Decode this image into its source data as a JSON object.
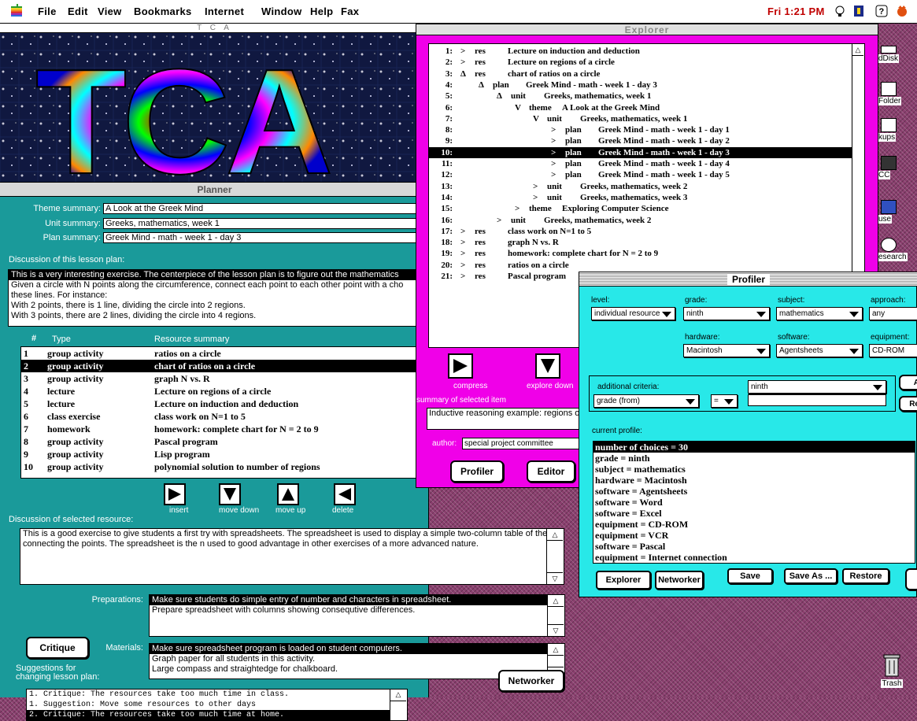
{
  "menubar": {
    "apple": "apple-icon",
    "items": [
      "File",
      "Edit",
      "View",
      "Bookmarks",
      "Internet",
      "Window",
      "Help",
      "Fax"
    ],
    "clock": "Fri 1:21 PM"
  },
  "desktop": {
    "icons": [
      {
        "label": "dDisk"
      },
      {
        "label": " Folder"
      },
      {
        "label": "kups"
      },
      {
        "label": "CC"
      },
      {
        "label": "use"
      },
      {
        "label": "esearch"
      },
      {
        "label": "Trash"
      }
    ]
  },
  "planner": {
    "tca_title": "T C A",
    "banner_text": "TCA",
    "title": "Planner",
    "theme_label": "Theme summary:",
    "theme_value": "A Look at the Greek Mind",
    "unit_label": "Unit summary:",
    "unit_value": "Greeks, mathematics, week 1",
    "plan_label": "Plan summary:",
    "plan_value": "Greek Mind - math - week 1 -  day  3",
    "discussion_label": "Discussion of this lesson plan:",
    "discussion_lines": [
      "This is a very interesting exercise. The centerpiece of the lesson plan is to figure out the mathematics",
      "Given a circle with N points along the circumference, connect each point to each other point with a cho",
      "these lines. For instance:",
      " With 2 points, there is 1 line, dividing the circle into 2 regions.",
      " With 3 points, there are 2 lines, dividing the circle into 4 regions."
    ],
    "col_num": "#",
    "col_type": "Type",
    "col_summary": "Resource summary",
    "resources": [
      {
        "n": "1",
        "type": "group activity",
        "summary": "ratios on a circle"
      },
      {
        "n": "2",
        "type": "group activity",
        "summary": "chart of ratios on  a circle"
      },
      {
        "n": "3",
        "type": "group activity",
        "summary": "graph N vs. R"
      },
      {
        "n": "4",
        "type": "lecture",
        "summary": "Lecture on regions of a circle"
      },
      {
        "n": "5",
        "type": "lecture",
        "summary": "Lecture on induction and deduction"
      },
      {
        "n": "6",
        "type": "class exercise",
        "summary": "class work on N=1 to 5"
      },
      {
        "n": "7",
        "type": "homework",
        "summary": "homework: complete chart for N = 2 to 9"
      },
      {
        "n": "8",
        "type": "group activity",
        "summary": "Pascal program"
      },
      {
        "n": "9",
        "type": "group activity",
        "summary": "Lisp program"
      },
      {
        "n": "10",
        "type": "group activity",
        "summary": "polynomial solution to number of regions"
      }
    ],
    "selected_resource": 2,
    "insert_label": "insert",
    "move_down_label": "move down",
    "move_up_label": "move up",
    "delete_label": "delete",
    "sel_resource_label": "Discussion of selected resource:",
    "sel_resource_lines": [
      "This is a good exercise to give students a first try with spreadsheets. The spreadsheet is used to display a simple two-column table of the",
      "connecting the points. The spreadsheet is the n used to good advantage in other exercises of a more advanced nature."
    ],
    "preparations_label": "Preparations:",
    "preparations_lines": [
      "Make sure students do simple entry of number and characters in spreadsheet.",
      "Prepare spreadsheet with columns showing consequtive differences."
    ],
    "critique_button": "Critique",
    "materials_label": "Materials:",
    "materials_lines": [
      "Make sure spreadsheet program is loaded on student computers.",
      "Graph paper for all students in this activity.",
      "Large compass and straightedge for chalkboard."
    ],
    "suggestions_label_1": "Suggestions for",
    "suggestions_label_2": "changing lesson plan:",
    "suggestions_lines": [
      "1. Critique:    The resources take too much time in class.",
      "1. Suggestion: Move some resources to other days",
      "2. Critique:    The resources take too much time at home."
    ],
    "networker_button": "Networker"
  },
  "explorer": {
    "title": "Explorer",
    "rows": [
      {
        "n": "1:",
        "mark": ">",
        "kind": "res",
        "text": "Lecture on induction and deduction",
        "indent": 0
      },
      {
        "n": "2:",
        "mark": ">",
        "kind": "res",
        "text": "Lecture on regions of a circle",
        "indent": 0
      },
      {
        "n": "3:",
        "mark": "Δ",
        "kind": "res",
        "text": "chart of ratios on  a circle",
        "indent": 0
      },
      {
        "n": "4:",
        "mark": "Δ",
        "kind": "plan",
        "text": "Greek Mind - math - week 1 -  day  3",
        "indent": 1
      },
      {
        "n": "5:",
        "mark": "Δ",
        "kind": "unit",
        "text": "Greeks, mathematics, week 1",
        "indent": 2
      },
      {
        "n": "6:",
        "mark": "V",
        "kind": "theme",
        "text": "A Look at the Greek Mind",
        "indent": 3
      },
      {
        "n": "7:",
        "mark": "V",
        "kind": "unit",
        "text": "Greeks, mathematics, week 1",
        "indent": 4
      },
      {
        "n": "8:",
        "mark": ">",
        "kind": "plan",
        "text": "Greek Mind - math - week 1 -  day  1",
        "indent": 5
      },
      {
        "n": "9:",
        "mark": ">",
        "kind": "plan",
        "text": "Greek Mind - math - week 1 -  day  2",
        "indent": 5
      },
      {
        "n": "10:",
        "mark": ">",
        "kind": "plan",
        "text": "Greek Mind - math - week 1 -  day  3",
        "indent": 5
      },
      {
        "n": "11:",
        "mark": ">",
        "kind": "plan",
        "text": "Greek Mind - math - week 1 -  day  4",
        "indent": 5
      },
      {
        "n": "12:",
        "mark": ">",
        "kind": "plan",
        "text": "Greek Mind - math - week 1 -  day  5",
        "indent": 5
      },
      {
        "n": "13:",
        "mark": ">",
        "kind": "unit",
        "text": "Greeks, mathematics, week 2",
        "indent": 4
      },
      {
        "n": "14:",
        "mark": ">",
        "kind": "unit",
        "text": "Greeks, mathematics, week 3",
        "indent": 4
      },
      {
        "n": "15:",
        "mark": ">",
        "kind": "theme",
        "text": "Exploring Computer Science",
        "indent": 3
      },
      {
        "n": "16:",
        "mark": ">",
        "kind": "unit",
        "text": "Greeks, mathematics, week 2",
        "indent": 2
      },
      {
        "n": "17:",
        "mark": ">",
        "kind": "res",
        "text": "class work on N=1 to 5",
        "indent": 0
      },
      {
        "n": "18:",
        "mark": ">",
        "kind": "res",
        "text": "graph N vs. R",
        "indent": 0
      },
      {
        "n": "19:",
        "mark": ">",
        "kind": "res",
        "text": "homework: complete chart for N = 2 to 9",
        "indent": 0
      },
      {
        "n": "20:",
        "mark": ">",
        "kind": "res",
        "text": "ratios on a circle",
        "indent": 0
      },
      {
        "n": "21:",
        "mark": ">",
        "kind": "res",
        "text": "Pascal program",
        "indent": 0
      }
    ],
    "selected_row": 10,
    "compress_label": "compress",
    "explore_down_label": "explore down",
    "summary_label": "summary of selected item",
    "summary_value": "Inductive reasoning example: regions of",
    "author_label": "author:",
    "author_value": "special project committee",
    "profiler_button": "Profiler",
    "editor_button": "Editor"
  },
  "profiler": {
    "title": "Profiler",
    "level_label": "level:",
    "level_value": "individual resource",
    "grade_label": "grade:",
    "grade_value": "ninth",
    "subject_label": "subject:",
    "subject_value": "mathematics",
    "approach_label": "approach:",
    "approach_value": "any",
    "hardware_label": "hardware:",
    "hardware_value": "Macintosh",
    "software_label": "software:",
    "software_value": "Agentsheets",
    "equipment_label": "equipment:",
    "equipment_value": "CD-ROM",
    "additional_label": "additional criteria:",
    "additional_value": "ninth",
    "criteria_field": "grade (from)",
    "operator": "=",
    "btn_add_partial": "A",
    "btn_re_partial": "Re",
    "current_profile_label": "current profile:",
    "profile_lines": [
      "number of choices = 30",
      "grade = ninth",
      "subject = mathematics",
      "hardware = Macintosh",
      "software = Agentsheets",
      "software = Word",
      "software = Excel",
      "equipment = CD-ROM",
      "equipment = VCR",
      "software = Pascal",
      "equipment = Internet connection"
    ],
    "explorer_button": "Explorer",
    "networker_button": "Networker",
    "save_button": "Save",
    "save_as_button": "Save As ...",
    "restore_button": "Restore"
  },
  "colors": {
    "teal": "#1a9a9a",
    "magenta": "#f000e8",
    "cyan": "#28e8e8",
    "clock": "#c00000"
  }
}
